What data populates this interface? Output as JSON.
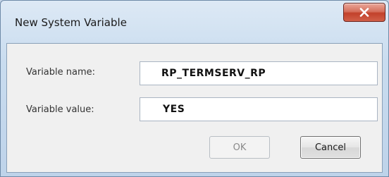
{
  "window": {
    "title": "New System Variable",
    "close_icon": "close-icon"
  },
  "form": {
    "name_label": "Variable name:",
    "name_value": "RP_TERMSERV_RP",
    "value_label": "Variable value:",
    "value_value": "YES"
  },
  "buttons": {
    "ok_label": "OK",
    "ok_enabled": false,
    "cancel_label": "Cancel"
  },
  "colors": {
    "close_button": "#c2412b",
    "title_bar": "#c9dcef"
  }
}
